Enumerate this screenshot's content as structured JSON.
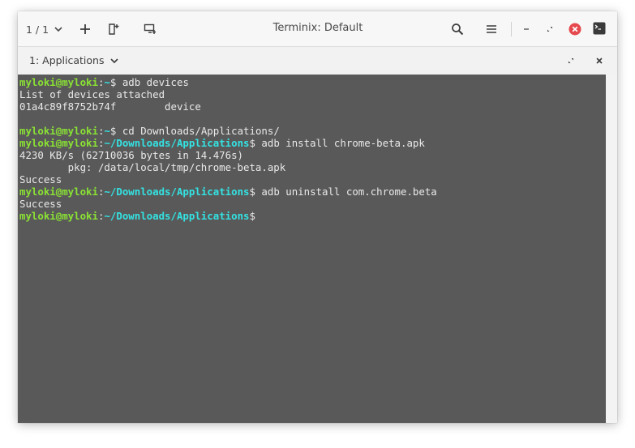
{
  "window": {
    "title": "Terminix: Default"
  },
  "titlebar": {
    "session_count": "1 / 1",
    "buttons": [
      "add-terminal",
      "new-session",
      "sync-input",
      "search",
      "menu",
      "minimize",
      "restore",
      "close",
      "terminal-icon"
    ]
  },
  "tab": {
    "title": "1: Applications"
  },
  "terminal": {
    "lines": [
      [
        {
          "t": "myloki@myloki",
          "c": "user"
        },
        {
          "t": ":",
          "c": "sym"
        },
        {
          "t": "~",
          "c": "path"
        },
        {
          "t": "$ adb devices",
          "c": "sym"
        }
      ],
      [
        {
          "t": "List of devices attached",
          "c": "sym"
        }
      ],
      [
        {
          "t": "01a4c89f8752b74f        device",
          "c": "sym"
        }
      ],
      [
        {
          "t": "",
          "c": "sym"
        }
      ],
      [
        {
          "t": "myloki@myloki",
          "c": "user"
        },
        {
          "t": ":",
          "c": "sym"
        },
        {
          "t": "~",
          "c": "path"
        },
        {
          "t": "$ cd Downloads/Applications/",
          "c": "sym"
        }
      ],
      [
        {
          "t": "myloki@myloki",
          "c": "user"
        },
        {
          "t": ":",
          "c": "sym"
        },
        {
          "t": "~/Downloads/Applications",
          "c": "path"
        },
        {
          "t": "$ adb install chrome-beta.apk",
          "c": "sym"
        }
      ],
      [
        {
          "t": "4230 KB/s (62710036 bytes in 14.476s)",
          "c": "sym"
        }
      ],
      [
        {
          "t": "        pkg: /data/local/tmp/chrome-beta.apk",
          "c": "sym"
        }
      ],
      [
        {
          "t": "Success",
          "c": "sym"
        }
      ],
      [
        {
          "t": "myloki@myloki",
          "c": "user"
        },
        {
          "t": ":",
          "c": "sym"
        },
        {
          "t": "~/Downloads/Applications",
          "c": "path"
        },
        {
          "t": "$ adb uninstall com.chrome.beta",
          "c": "sym"
        }
      ],
      [
        {
          "t": "Success",
          "c": "sym"
        }
      ],
      [
        {
          "t": "myloki@myloki",
          "c": "user"
        },
        {
          "t": ":",
          "c": "sym"
        },
        {
          "t": "~/Downloads/Applications",
          "c": "path"
        },
        {
          "t": "$",
          "c": "sym"
        }
      ]
    ]
  },
  "colors": {
    "terminal_bg": "#595959",
    "prompt_user": "#8ae234",
    "prompt_path": "#34e2e2",
    "close_button": "#e5484d"
  }
}
